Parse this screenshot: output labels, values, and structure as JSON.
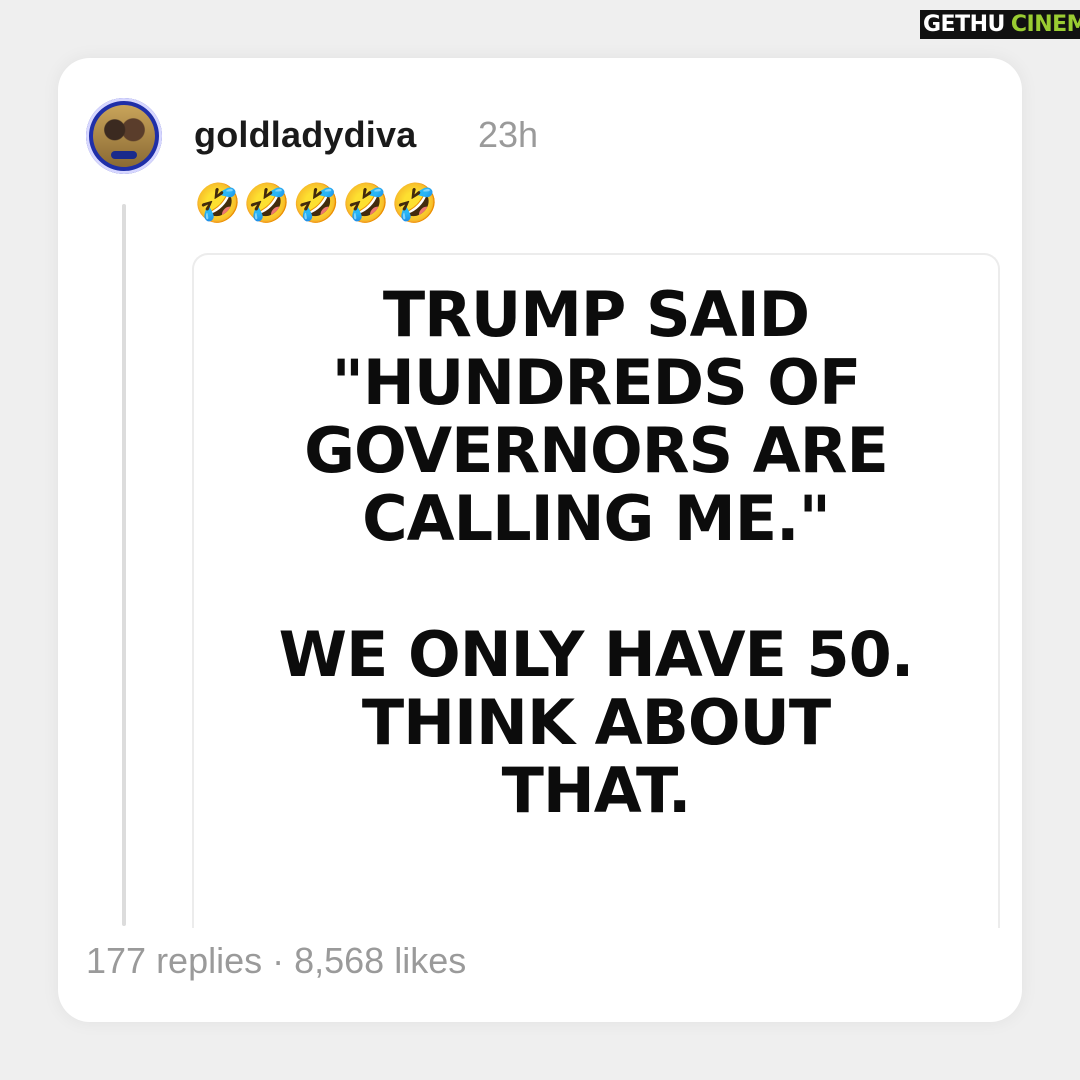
{
  "watermark": {
    "part1": "GETHU",
    "part2": "CINEMA"
  },
  "post": {
    "username": "goldladydiva",
    "timestamp": "23h",
    "emojis": "🤣🤣🤣🤣🤣",
    "image_text": {
      "line1": "TRUMP SAID",
      "line2": "\"HUNDREDS OF",
      "line3": "GOVERNORS ARE",
      "line4": "CALLING ME.\"",
      "line5": "WE ONLY HAVE 50.",
      "line6": "THINK ABOUT",
      "line7": "THAT."
    },
    "stats": "177 replies · 8,568 likes"
  }
}
